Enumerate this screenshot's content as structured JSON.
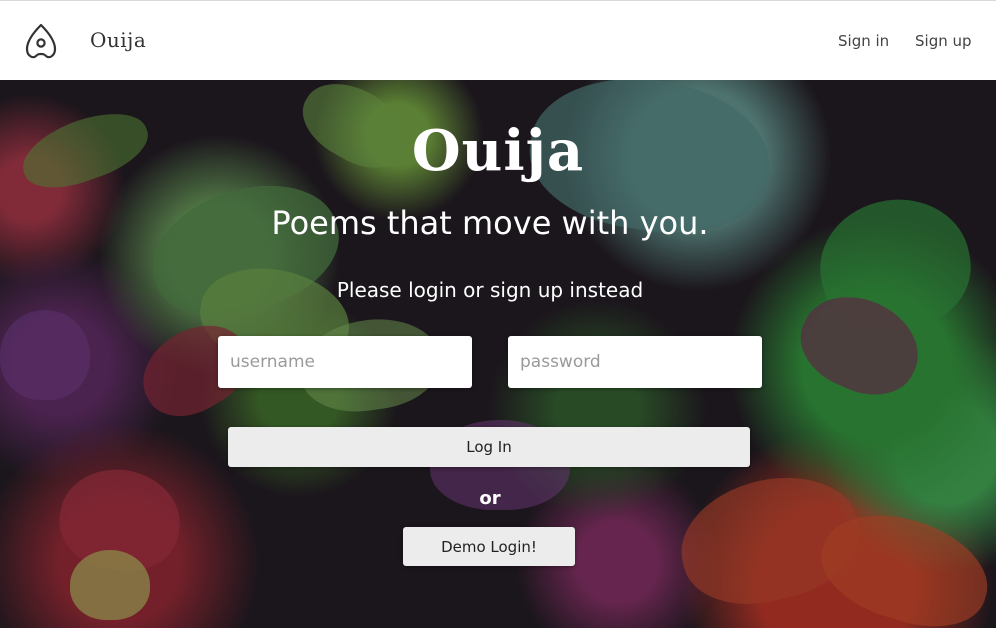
{
  "navbar": {
    "brand": "Ouija",
    "signin_label": "Sign in",
    "signup_label": "Sign up",
    "logo_icon": "ouija-planchette-icon"
  },
  "hero": {
    "title": "Ouija",
    "subtitle": "Poems that move with you.",
    "note": "Please login or sign up instead",
    "username_placeholder": "username",
    "password_placeholder": "password",
    "login_label": "Log In",
    "or_text": "or",
    "demo_label": "Demo Login!"
  },
  "colors": {
    "button_bg": "#ececec",
    "text_white": "#ffffff",
    "nav_text": "#444444"
  }
}
